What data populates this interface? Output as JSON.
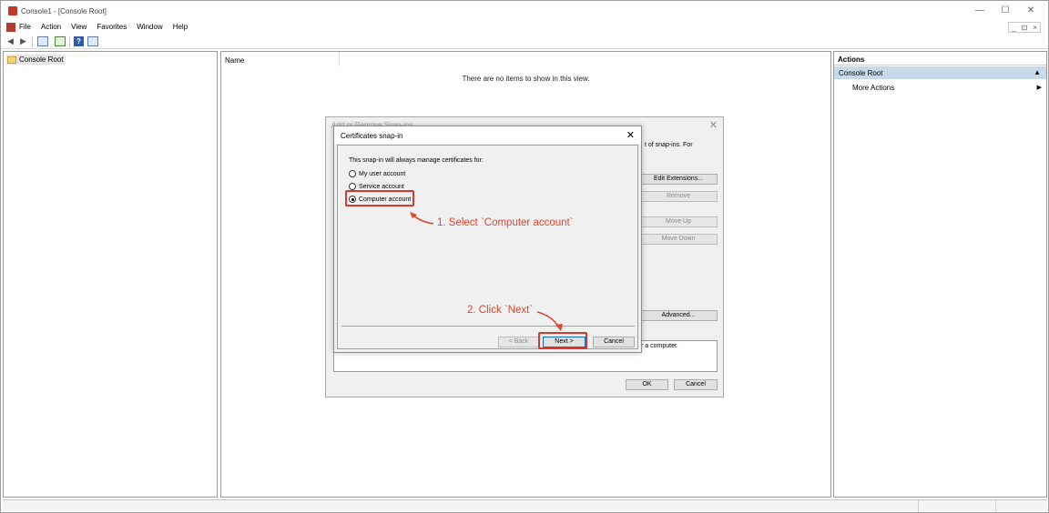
{
  "window": {
    "title": "Console1 - [Console Root]",
    "controls": [
      "—",
      "☐",
      "✕"
    ],
    "mdi_controls": [
      "_",
      "⊡",
      "×"
    ]
  },
  "menu": {
    "items": [
      "File",
      "Action",
      "View",
      "Favorites",
      "Window",
      "Help"
    ]
  },
  "tree": {
    "root_label": "Console Root"
  },
  "center": {
    "column_name": "Name",
    "empty_message": "There are no items to show in this view."
  },
  "actions": {
    "header": "Actions",
    "section": "Console Root",
    "item": "More Actions"
  },
  "addremove_dialog": {
    "title": "Add or Remove Snap-ins",
    "partial_text_top": "t of snap-ins. For",
    "partial_text_bottom": "r a computer.",
    "buttons": {
      "edit_extensions": "Edit Extensions...",
      "remove": "Remove",
      "move_up": "Move Up",
      "move_down": "Move Down",
      "advanced": "Advanced...",
      "ok": "OK",
      "cancel": "Cancel"
    }
  },
  "cert_dialog": {
    "title": "Certificates snap-in",
    "description": "This snap-in will always manage certificates for:",
    "options": [
      {
        "label": "My user account",
        "selected": false
      },
      {
        "label": "Service account",
        "selected": false
      },
      {
        "label": "Computer account",
        "selected": true
      }
    ],
    "buttons": {
      "back": "< Back",
      "next": "Next >",
      "cancel": "Cancel"
    }
  },
  "annotations": {
    "step1": "1. Select `Computer account`",
    "step2": "2. Click `Next`",
    "color": "#e0452c"
  }
}
